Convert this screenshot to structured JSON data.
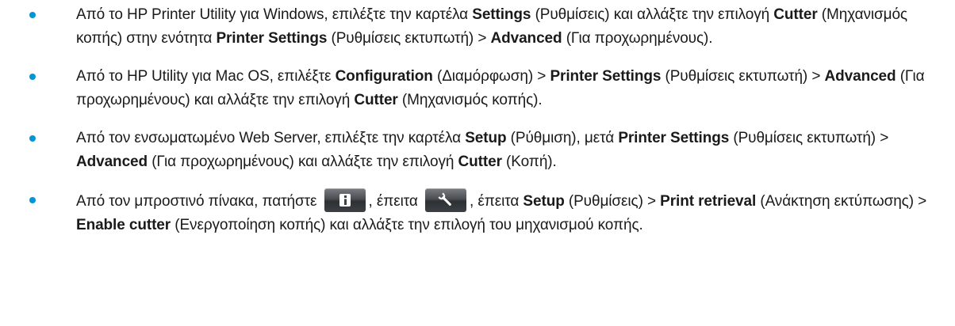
{
  "colors": {
    "bullet": "#0096d6",
    "text": "#1a1a1a",
    "icon_button_bg": "#3c4044"
  },
  "icons": {
    "info_button": "info-icon",
    "settings_button": "wrench-icon"
  },
  "items": [
    {
      "t1": "Από το HP Printer Utility για Windows, επιλέξτε την καρτέλα ",
      "b1": "Settings",
      "t2": " (Ρυθμίσεις) και αλλάξτε την επιλογή ",
      "b2": "Cutter",
      "t3": " (Μηχανισμός κοπής) στην ενότητα ",
      "b3": "Printer Settings",
      "t4": " (Ρυθμίσεις εκτυπωτή) > ",
      "b4": "Advanced",
      "t5": " (Για προχωρημένους)."
    },
    {
      "t1": "Από το HP Utility για Mac OS, επιλέξτε ",
      "b1": "Configuration",
      "t2": " (Διαμόρφωση) > ",
      "b2": "Printer Settings",
      "t3": " (Ρυθμίσεις εκτυπωτή) > ",
      "b3": "Advanced",
      "t4": " (Για προχωρημένους) και αλλάξτε την επιλογή ",
      "b4": "Cutter",
      "t5": " (Μηχανισμός κοπής)."
    },
    {
      "t1": "Από τον ενσωματωμένο Web Server, επιλέξτε την καρτέλα ",
      "b1": "Setup",
      "t2": " (Ρύθμιση), μετά ",
      "b2": "Printer Settings",
      "t3": " (Ρυθμίσεις εκτυπωτή) > ",
      "b3": "Advanced",
      "t4": " (Για προχωρημένους) και αλλάξτε την επιλογή ",
      "b4": "Cutter",
      "t5": " (Κοπή)."
    },
    {
      "t1": "Από τον μπροστινό πίνακα, πατήστε ",
      "t2": ", έπειτα ",
      "t3": ", έπειτα ",
      "b1": "Setup",
      "t4": " (Ρυθμίσεις) > ",
      "b2": "Print retrieval",
      "t5": " (Ανάκτηση εκτύπωσης) > ",
      "b3": "Enable cutter",
      "t6": " (Ενεργοποίηση κοπής) και αλλάξτε την επιλογή του μηχανισμού κοπής."
    }
  ]
}
